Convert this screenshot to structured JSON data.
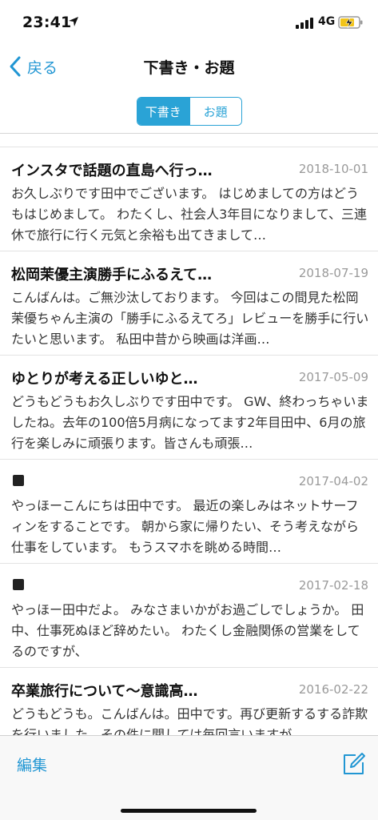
{
  "status_bar": {
    "time": "23:41",
    "network": "4G",
    "location_icon": "location-arrow-icon",
    "signal_icon": "signal-bars-icon",
    "battery_icon": "battery-charging-icon"
  },
  "nav": {
    "back_label": "戻る",
    "title": "下書き・お題"
  },
  "segments": {
    "drafts": "下書き",
    "topics": "お題",
    "selected": "下書き"
  },
  "posts": [
    {
      "title": "インスタで話題の直島へ行っ…",
      "date": "2018-10-01",
      "excerpt": "お久しぶりです田中でございます。 はじめましての方はどうもはじめまして。 わたくし、社会人3年目になりまして、三連休で旅行に行く元気と余裕も出てきまして…"
    },
    {
      "title": "松岡茉優主演勝手にふるえて…",
      "date": "2018-07-19",
      "excerpt": "こんばんは。ご無沙汰しております。 今回はこの間見た松岡茉優ちゃん主演の「勝手にふるえてろ」レビューを勝手に行いたいと思います。 私田中昔から映画は洋画…"
    },
    {
      "title": "ゆとりが考える正しいゆと…",
      "date": "2017-05-09",
      "excerpt": "どうもどうもお久しぶりです田中です。 GW、終わっちゃいましたね。去年の100倍5月病になってます2年目田中、6月の旅行を楽しみに頑張ります。皆さんも頑張…"
    },
    {
      "title": "",
      "date": "2017-04-02",
      "excerpt": "やっほーこんにちは田中です。 最近の楽しみはネットサーフィンをすることです。 朝から家に帰りたい、そう考えながら仕事をしています。 もうスマホを眺める時間…"
    },
    {
      "title": "",
      "date": "2017-02-18",
      "excerpt": "やっほー田中だよ。 みなさまいかがお過ごしでしょうか。 田中、仕事死ぬほど辞めたい。 わたくし金融関係の営業をしてるのですが、"
    },
    {
      "title": "卒業旅行について〜意識高…",
      "date": "2016-02-22",
      "excerpt": "どうもどうも。こんばんは。田中です。再び更新するする詐欺を行いました。その件に関しては毎回言いますが"
    }
  ],
  "toolbar": {
    "edit_label": "編集",
    "compose_icon": "compose-icon"
  },
  "colors": {
    "accent": "#2aa3d6",
    "link": "#2196d3",
    "date": "#9a9a9a"
  }
}
